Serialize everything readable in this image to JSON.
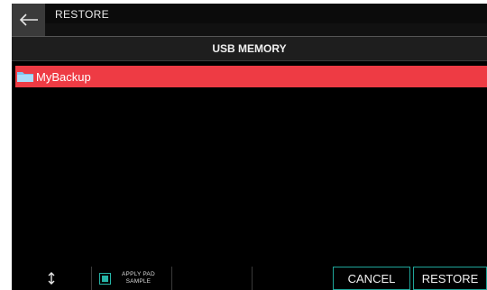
{
  "window": {
    "title": "RESTORE"
  },
  "header": {
    "title": "USB MEMORY"
  },
  "list": {
    "items": [
      {
        "name": "MyBackup",
        "selected": true
      }
    ]
  },
  "footer": {
    "apply_pad_label": "APPLY PAD",
    "sample_label": "SAMPLE",
    "apply_pad_sample_checked": true,
    "cancel_label": "CANCEL",
    "restore_label": "RESTORE"
  },
  "colors": {
    "selection": "#ee3b44",
    "accent": "#26b3a6",
    "background": "#000000"
  },
  "icons": {
    "back": "back-arrow-icon",
    "folder": "folder-icon",
    "scroll": "up-down-arrow-icon"
  }
}
